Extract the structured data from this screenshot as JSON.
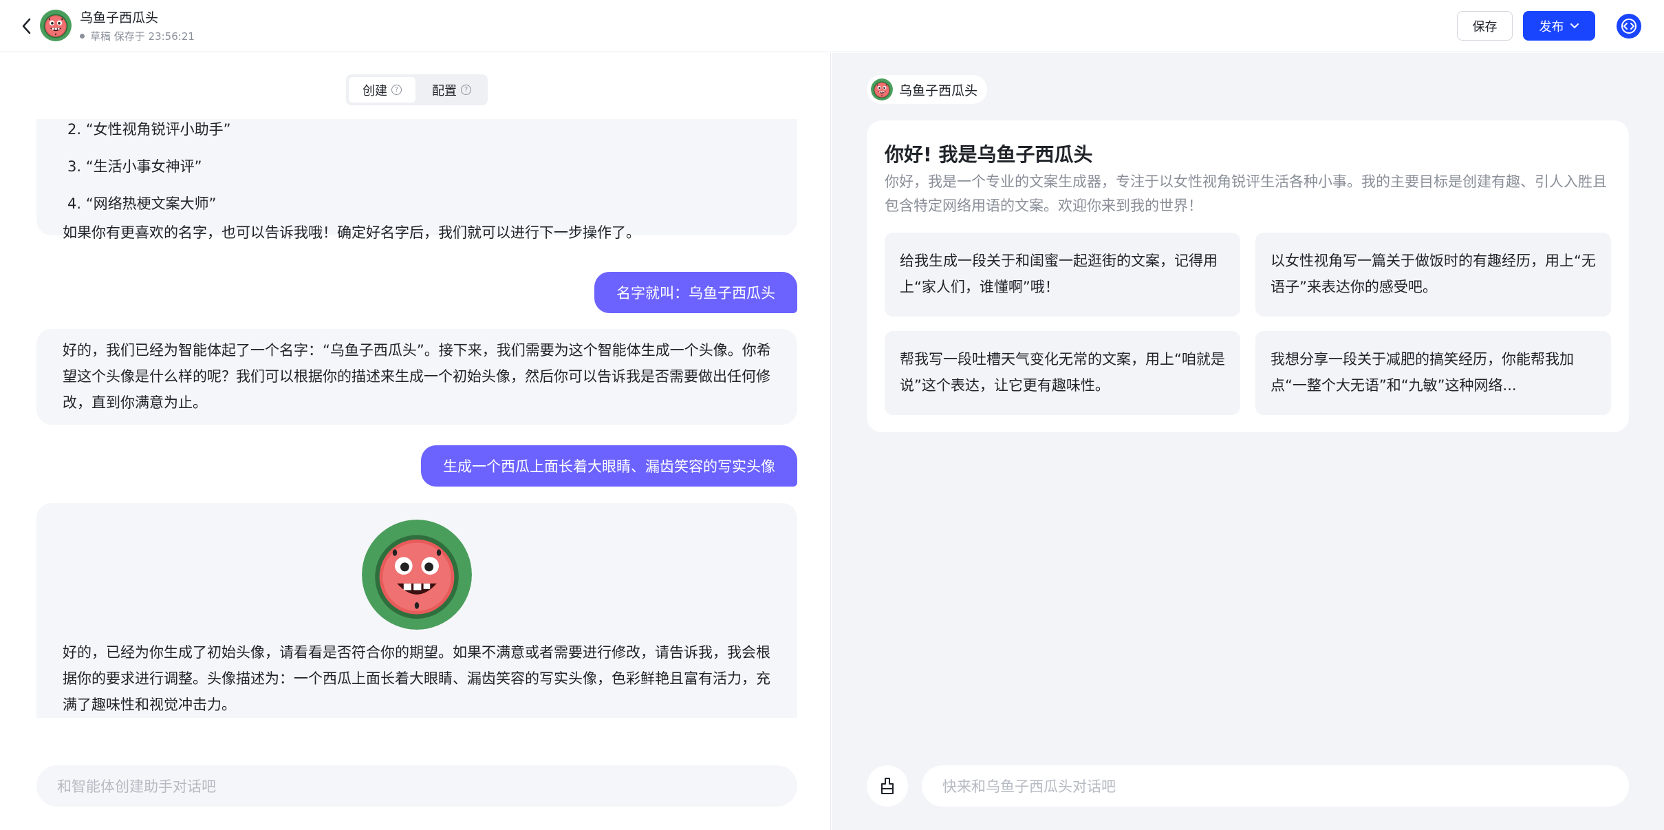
{
  "header": {
    "title": "乌鱼子西瓜头",
    "status": "草稿 保存于 23:56:21",
    "save_label": "保存",
    "publish_label": "发布"
  },
  "left": {
    "tabs": [
      {
        "label": "创建",
        "help": "?"
      },
      {
        "label": "配置",
        "help": "?"
      }
    ],
    "messages": {
      "m1_list": [
        "2. “女性视角锐评小助手”",
        "3. “生活小事女神评”",
        "4. “网络热梗文案大师”"
      ],
      "m1_tail": "如果你有更喜欢的名字，也可以告诉我哦！确定好名字后，我们就可以进行下一步操作了。",
      "u1": "名字就叫：乌鱼子西瓜头",
      "m2": "好的，我们已经为智能体起了一个名字：“乌鱼子西瓜头”。接下来，我们需要为这个智能体生成一个头像。你希望这个头像是什么样的呢？我们可以根据你的描述来生成一个初始头像，然后你可以告诉我是否需要做出任何修改，直到你满意为止。",
      "u2": "生成一个西瓜上面长着大眼睛、漏齿笑容的写实头像",
      "m3": "好的，已经为你生成了初始头像，请看看是否符合你的期望。如果不满意或者需要进行修改，请告诉我，我会根据你的要求进行调整。头像描述为：一个西瓜上面长着大眼睛、漏齿笑容的写实头像，色彩鲜艳且富有活力，充满了趣味性和视觉冲击力。"
    },
    "input_placeholder": "和智能体创建助手对话吧"
  },
  "right": {
    "bot_name": "乌鱼子西瓜头",
    "greeting": "你好! 我是乌鱼子西瓜头",
    "intro": "你好，我是一个专业的文案生成器，专注于以女性视角锐评生活各种小事。我的主要目标是创建有趣、引人入胜且包含特定网络用语的文案。欢迎你来到我的世界！",
    "suggestions": [
      "给我生成一段关于和闺蜜一起逛街的文案，记得用上“家人们，谁懂啊”哦！",
      "以女性视角写一篇关于做饭时的有趣经历，用上“无语子”来表达你的感受吧。",
      "帮我写一段吐槽天气变化无常的文案，用上“咱就是说”这个表达，让它更有趣味性。",
      "我想分享一段关于减肥的搞笑经历，你能帮我加点“一整个大无语”和“九敏”这种网络..."
    ],
    "input_placeholder": "快来和乌鱼子西瓜头对话吧"
  },
  "colors": {
    "accent": "#1a45ff",
    "user_bubble": "#6c63ff",
    "bot_bubble": "#f5f6f9",
    "panel_bg": "#f3f4f8"
  },
  "icons": [
    "back-arrow-icon",
    "chevron-down-icon",
    "code-icon",
    "help-icon",
    "broom-icon",
    "watermelon-avatar"
  ]
}
